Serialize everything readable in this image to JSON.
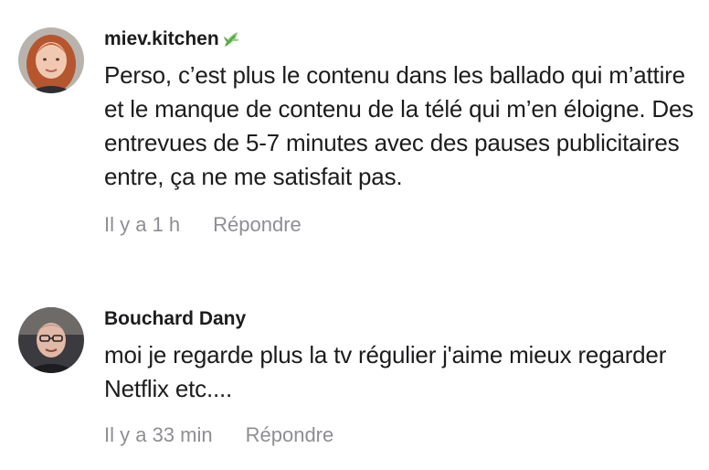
{
  "comments": [
    {
      "author": "miev.kitchen",
      "author_icon": "leaf-icon",
      "text": "Perso, c’est plus le contenu dans les ballado qui m’attire et le manque de contenu de la télé qui m’en éloigne. Des entrevues de 5-7 minutes avec des pauses publicitaires entre, ça ne me satisfait pas.",
      "time": "Il y a 1 h",
      "reply_label": "Répondre"
    },
    {
      "author": "Bouchard Dany",
      "text": "moi je regarde plus la tv régulier j'aime mieux regarder Netflix etc....",
      "time": "Il y a 33 min",
      "reply_label": "Répondre"
    }
  ],
  "colors": {
    "text": "#1c1c1e",
    "meta": "#8e8e93",
    "leaf": "#6bbf59"
  }
}
